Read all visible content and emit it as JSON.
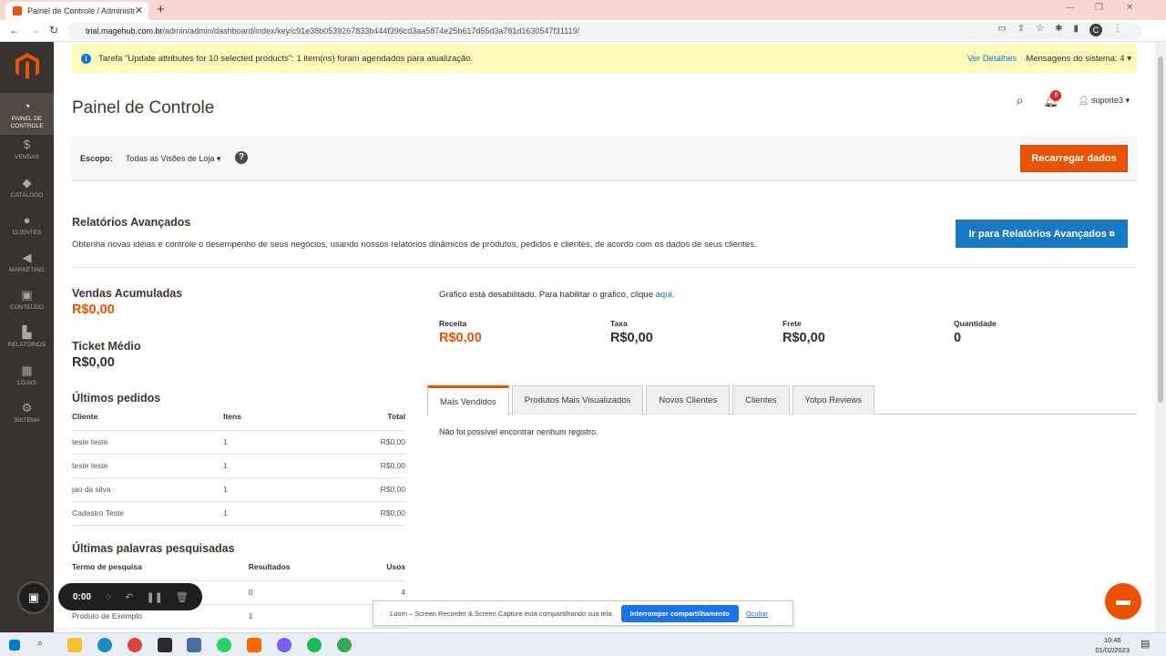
{
  "browser": {
    "tab_title": "Painel de Controle / Administraç",
    "url_host": "trial.magehub.com.br",
    "url_path": "/admin/admin/dashboard/index/key/c91e38b0539267833b444f396cd3aa5874e25b617d55d3a781d1630547f31119/",
    "profile_initial": "C"
  },
  "sidebar": {
    "items": [
      {
        "label": "PAINEL DE CONTROLE",
        "icon": "dashboard-icon"
      },
      {
        "label": "VENDAS",
        "icon": "dollar-icon"
      },
      {
        "label": "CATÁLOGO",
        "icon": "cube-icon"
      },
      {
        "label": "CLIENTES",
        "icon": "person-icon"
      },
      {
        "label": "MARKETING",
        "icon": "megaphone-icon"
      },
      {
        "label": "CONTEÚDO",
        "icon": "layout-icon"
      },
      {
        "label": "RELATÓRIOS",
        "icon": "bar-chart-icon"
      },
      {
        "label": "LOJAS",
        "icon": "store-icon"
      },
      {
        "label": "SISTEMA",
        "icon": "gear-icon"
      }
    ]
  },
  "notice": {
    "message": "Tarefa \"Update attributes for 10 selected products\": 1 item(ns) foram agendados para atualização.",
    "details_link": "Ver Detalhes",
    "system_messages": "Mensagens do sistema: 4"
  },
  "header": {
    "title": "Painel de Controle",
    "notifications_count": "6",
    "user": "suporte3"
  },
  "scope": {
    "label": "Escopo:",
    "value": "Todas as Visões de Loja",
    "reload_button": "Recarregar dados"
  },
  "advanced": {
    "title": "Relatórios Avançados",
    "description": "Obtenha novas idéias e controle o desempenho de seus negócios, usando nossos relatórios dinâmicos de produtos, pedidos e clientes, de acordo com os dados de seus clientes.",
    "button": "Ir para Relatórios Avançados"
  },
  "metrics": {
    "lifetime_label": "Vendas Acumuladas",
    "lifetime_value": "R$0,00",
    "avg_label": "Ticket Médio",
    "avg_value": "R$0,00"
  },
  "chart_notice": {
    "text": "Gráfico está desabilitado. Para habilitar o gráfico, clique ",
    "link": "aqui",
    "suffix": "."
  },
  "stats": [
    {
      "label": "Receita",
      "value": "R$0,00"
    },
    {
      "label": "Taxa",
      "value": "R$0,00"
    },
    {
      "label": "Frete",
      "value": "R$0,00"
    },
    {
      "label": "Quantidade",
      "value": "0"
    }
  ],
  "last_orders": {
    "title": "Últimos pedidos",
    "columns": [
      "Cliente",
      "Itens",
      "Total"
    ],
    "rows": [
      [
        "teste teste",
        "1",
        "R$0,00"
      ],
      [
        "teste teste",
        "1",
        "R$0,00"
      ],
      [
        "jao da silva",
        "1",
        "R$0,00"
      ],
      [
        "Cadastro Teste",
        "1",
        "R$0,00"
      ]
    ]
  },
  "last_search": {
    "title": "Últimas palavras pesquisadas",
    "columns": [
      "Termo de pesquisa",
      "Resultados",
      "Usos"
    ],
    "rows": [
      [
        "",
        "0",
        "4"
      ],
      [
        "Produto de Exemplo",
        "1",
        ""
      ]
    ]
  },
  "tabs": [
    "Mais Vendidos",
    "Produtos Mais Visualizados",
    "Novos Clientes",
    "Clientes",
    "Yotpo Reviews"
  ],
  "empty_message": "Não foi possível encontrar nenhum registro.",
  "recorder": {
    "time": "0:00"
  },
  "share": {
    "message": "Loom – Screen Recorder & Screen Capture está compartilhando sua tela.",
    "stop": "Interromper compartilhamento",
    "hide": "Ocultar"
  },
  "taskbar": {
    "time": "10:46",
    "date": "01/02/2023"
  }
}
